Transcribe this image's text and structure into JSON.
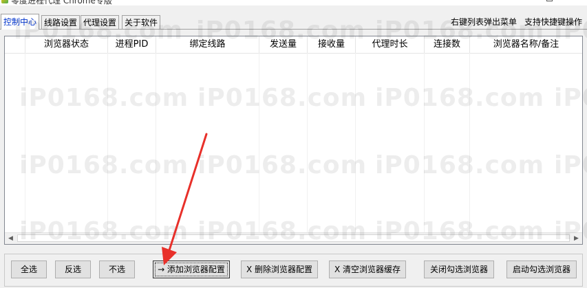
{
  "window": {
    "title": "零度进程代理 Chrome专版",
    "maximize_glyph": "□",
    "close_glyph": "✕"
  },
  "tabs": [
    {
      "label": "控制中心",
      "active": true
    },
    {
      "label": "线路设置",
      "active": false
    },
    {
      "label": "代理设置",
      "active": false
    },
    {
      "label": "关于软件",
      "active": false
    }
  ],
  "hints": {
    "right_click": "右键列表弹出菜单",
    "shortcut": "支持快捷键操作"
  },
  "table": {
    "columns": [
      "",
      "浏览器状态",
      "进程PID",
      "绑定线路",
      "发送量",
      "接收量",
      "代理时长",
      "连接数",
      "浏览器名称/备注"
    ],
    "rows": []
  },
  "scrollbar": {
    "left_arrow": "◀",
    "right_arrow": "▶"
  },
  "buttons": {
    "select_all": "全选",
    "invert": "反选",
    "select_none": "不选",
    "add_config": "→ 添加浏览器配置",
    "delete_config": "X 删除浏览器配置",
    "clear_cache": "X 清空浏览器缓存",
    "close_selected": "关闭勾选浏览器",
    "start_selected": "启动勾选浏览器"
  },
  "watermark": "iP0168.com",
  "colors": {
    "active_tab_text": "#0033cc",
    "annotation_arrow": "#e8302a"
  }
}
